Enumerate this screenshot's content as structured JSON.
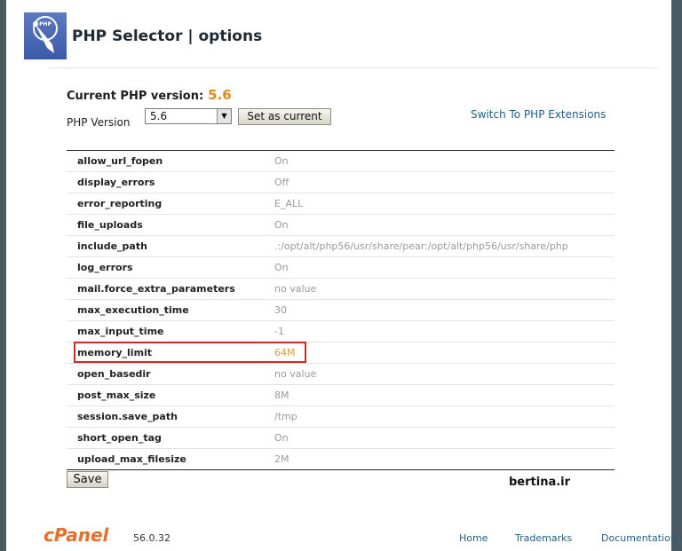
{
  "header": {
    "title": "PHP Selector | options"
  },
  "current_version": {
    "label": "Current PHP version:",
    "value": "5.6"
  },
  "version_selector": {
    "label": "PHP Version",
    "selected": "5.6",
    "set_current_label": "Set as current"
  },
  "extensions_link": "Switch To PHP Extensions",
  "options": [
    {
      "name": "allow_url_fopen",
      "value": "On"
    },
    {
      "name": "display_errors",
      "value": "Off"
    },
    {
      "name": "error_reporting",
      "value": "E_ALL"
    },
    {
      "name": "file_uploads",
      "value": "On"
    },
    {
      "name": "include_path",
      "value": ".:/opt/alt/php56/usr/share/pear:/opt/alt/php56/usr/share/php"
    },
    {
      "name": "log_errors",
      "value": "On"
    },
    {
      "name": "mail.force_extra_parameters",
      "value": "no value"
    },
    {
      "name": "max_execution_time",
      "value": "30"
    },
    {
      "name": "max_input_time",
      "value": "-1"
    },
    {
      "name": "memory_limit",
      "value": "64M"
    },
    {
      "name": "open_basedir",
      "value": "no value"
    },
    {
      "name": "post_max_size",
      "value": "8M"
    },
    {
      "name": "session.save_path",
      "value": "/tmp"
    },
    {
      "name": "short_open_tag",
      "value": "On"
    },
    {
      "name": "upload_max_filesize",
      "value": "2M"
    }
  ],
  "save_label": "Save",
  "watermark": "bertina.ir",
  "footer": {
    "logo_text": "cPanel",
    "version": "56.0.32",
    "links": {
      "home": "Home",
      "trademarks": "Trademarks",
      "documentation": "Documentation"
    }
  },
  "colors": {
    "accent": "#e08a1e",
    "link": "#1f5f86",
    "highlight_border": "#cc2a2a"
  }
}
